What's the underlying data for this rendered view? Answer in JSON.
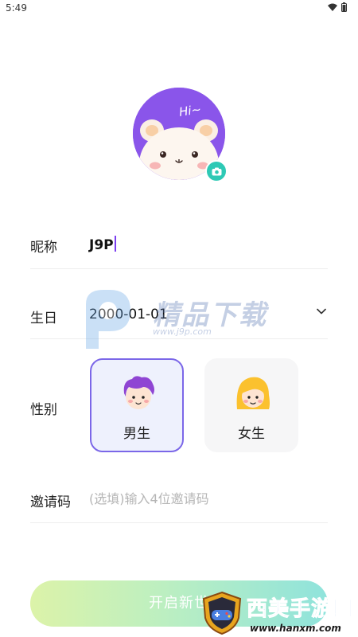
{
  "status_bar": {
    "time": "5:49"
  },
  "profile": {
    "avatar_text": "Hi~",
    "nickname_label": "昵称",
    "nickname_value": "J9P",
    "birthday_label": "生日",
    "birthday_value": "2000-01-01",
    "gender_label": "性别",
    "gender_options": [
      {
        "label": "男生",
        "selected": true
      },
      {
        "label": "女生",
        "selected": false
      }
    ],
    "invite_label": "邀请码",
    "invite_placeholder": "(选填)输入4位邀请码",
    "submit_label": "开启新世"
  },
  "colors": {
    "accent_purple": "#7b67e8",
    "camera_badge": "#2ec9b5",
    "avatar_bg": "#8a55ea"
  },
  "watermarks": {
    "center_text": "精品下载",
    "center_url": "www.j9p.com",
    "corner_text": "西美手游网",
    "corner_url": "www.hanxm.com"
  }
}
